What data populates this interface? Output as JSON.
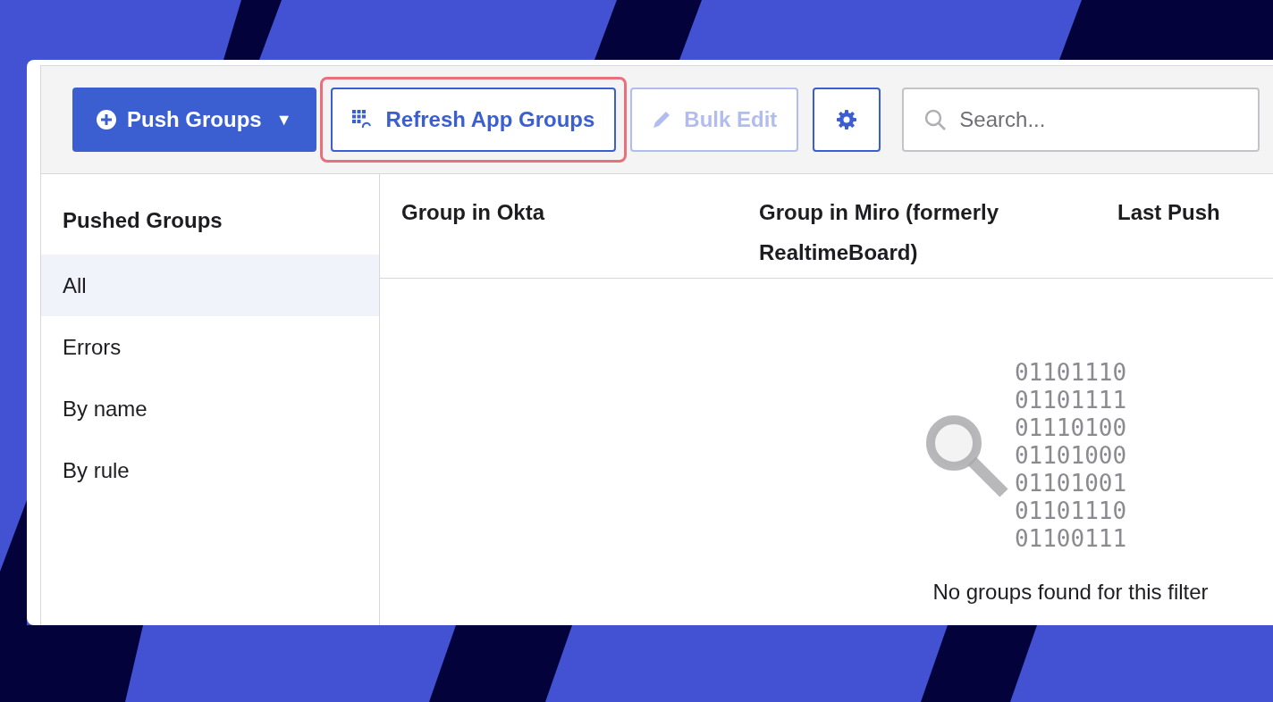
{
  "toolbar": {
    "buttons": [
      {
        "kind": "primary",
        "label": "Push Groups",
        "caret": "▼",
        "disabled": false,
        "highlighted": false
      },
      {
        "kind": "secondary",
        "label": "Refresh App Groups",
        "disabled": false,
        "highlighted": true
      },
      {
        "kind": "secondary",
        "label": "Bulk Edit",
        "disabled": true,
        "highlighted": false
      },
      {
        "kind": "settings",
        "disabled": false,
        "highlighted": false
      }
    ],
    "search": {
      "placeholder": "Search..."
    }
  },
  "sidebar": {
    "title": "Pushed Groups",
    "items": [
      {
        "label": "All",
        "selected": true
      },
      {
        "label": "Errors",
        "selected": false
      },
      {
        "label": "By name",
        "selected": false
      },
      {
        "label": "By rule",
        "selected": false
      }
    ]
  },
  "table": {
    "columns": [
      "Group in Okta",
      "Group in Miro (formerly RealtimeBoard)",
      "Last Push"
    ],
    "empty_state": {
      "binary_lines": [
        "01101110",
        "01101111",
        "01110100",
        "01101000",
        "01101001",
        "01101110",
        "01100111"
      ],
      "message": "No groups found for this filter"
    }
  }
}
